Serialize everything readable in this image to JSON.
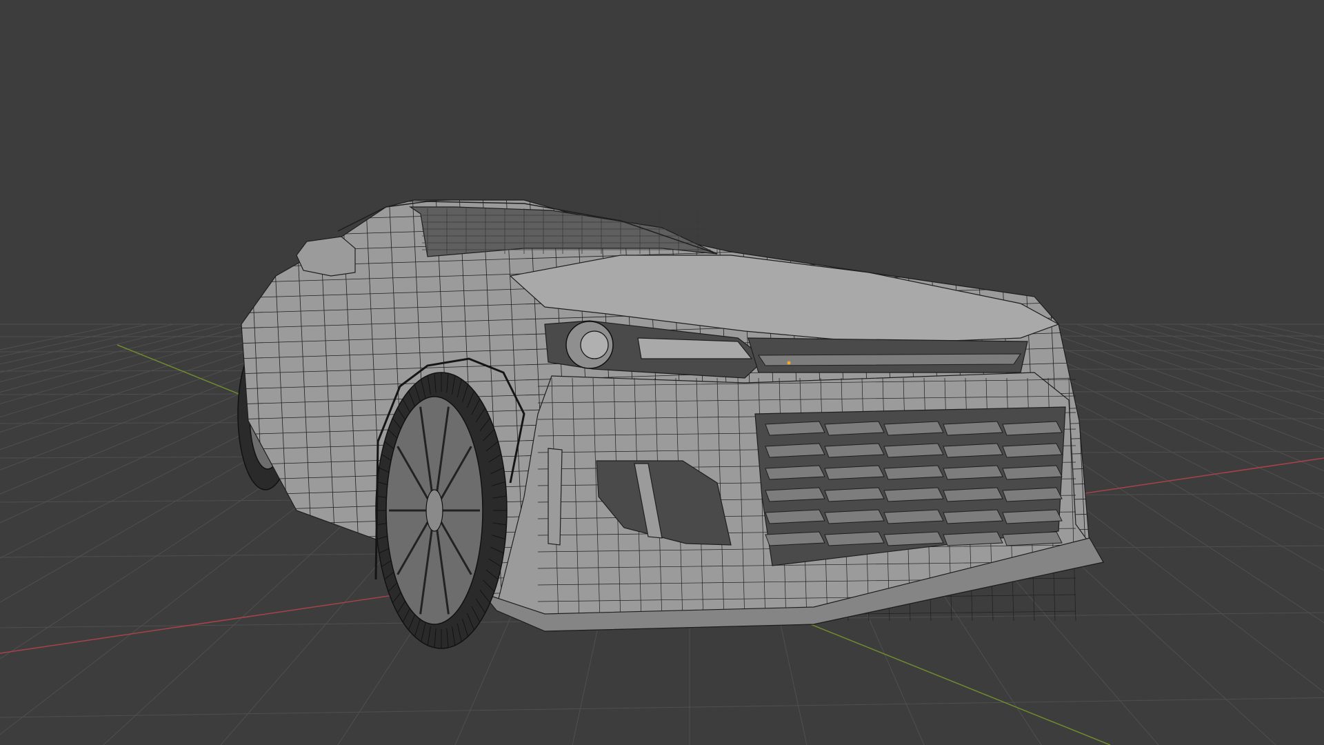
{
  "viewport": {
    "background": "#3d3d3d",
    "grid_color": "#4f4f4f",
    "x_axis_color": "#a8424a",
    "y_axis_color": "#6e8c2e",
    "model": {
      "body_color": "#9b9b9b",
      "body_shade": "#858585",
      "wire_color": "#1e1e1e",
      "tire_color": "#2a2a2a",
      "selected_vertex_color": "#f5a623"
    }
  }
}
